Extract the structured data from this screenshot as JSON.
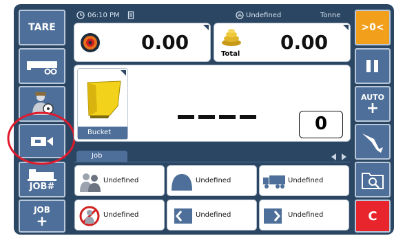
{
  "left_buttons": {
    "tare": "TARE",
    "job_hash": "JOB#",
    "job_add_line1": "JOB",
    "job_add_line2": "+"
  },
  "right_buttons": {
    "zero": ">0<",
    "auto_line1": "AUTO",
    "auto_line2": "+",
    "clear": "C"
  },
  "status": {
    "time": "06:10 PM",
    "material": "Undefined",
    "unit": "Tonne"
  },
  "weights": {
    "current": "0.00",
    "total": "0.00",
    "total_label": "Total"
  },
  "bucket": {
    "label": "Bucket",
    "display": "----",
    "count": "0"
  },
  "job_tab": {
    "label": "Job"
  },
  "job_fields": [
    {
      "icon": "customer-icon",
      "value": "Undefined"
    },
    {
      "icon": "location-icon",
      "value": "Undefined"
    },
    {
      "icon": "truck-icon",
      "value": "Undefined"
    },
    {
      "icon": "no-operator-icon",
      "value": "Undefined"
    },
    {
      "icon": "source-icon",
      "value": "Undefined"
    },
    {
      "icon": "destination-icon",
      "value": "Undefined"
    }
  ],
  "colors": {
    "frame": "#2b4663",
    "button": "#4d6f99",
    "zero": "#f2a01c",
    "clear": "#e8252c",
    "highlight_circle": "#e0192b"
  }
}
